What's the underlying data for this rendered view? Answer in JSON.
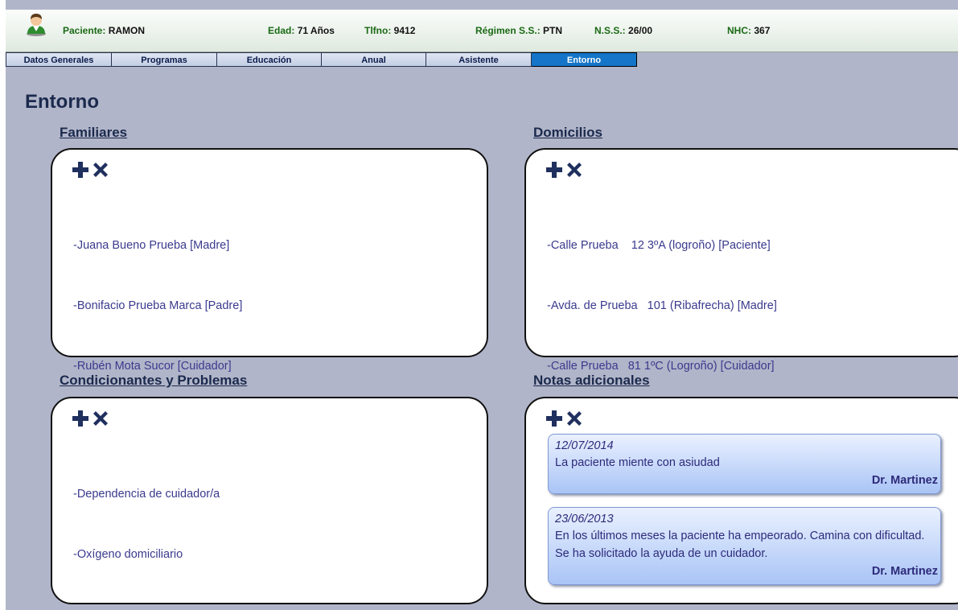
{
  "header": {
    "patient_label": "Paciente:",
    "patient_value": "RAMON",
    "age_label": "Edad:",
    "age_value": "71 Años",
    "phone_label": "Tlfno:",
    "phone_value": "9412",
    "regime_label": "Régimen S.S.:",
    "regime_value": "PTN",
    "nss_label": "N.S.S.:",
    "nss_value": "26/00",
    "nhc_label": "NHC:",
    "nhc_value": "367",
    "avatar_icon": "user-avatar-icon"
  },
  "tabs": [
    {
      "label": "Datos Generales"
    },
    {
      "label": "Programas"
    },
    {
      "label": "Educación"
    },
    {
      "label": "Anual"
    },
    {
      "label": "Asistente"
    },
    {
      "label": "Entorno"
    }
  ],
  "active_tab": "Entorno",
  "page_title": "Entorno",
  "sections": {
    "familiares": {
      "title": "Familiares",
      "items": [
        "-Juana Bueno Prueba [Madre]",
        "-Bonifacio Prueba Marca [Padre]",
        "-Rubén Mota Sucor [Cuidador]"
      ]
    },
    "domicilios": {
      "title": "Domicilios",
      "items": [
        "-Calle Prueba    12 3ºA (logroño) [Paciente]",
        "-Avda. de Prueba   101 (Ribafrecha) [Madre]",
        "-Calle Prueba   81 1ºC (Logroño) [Cuidador]"
      ]
    },
    "condicionantes": {
      "title": "Condicionantes y Problemas",
      "items": [
        "-Dependencia de cuidador/a",
        "-Oxígeno domiciliario"
      ]
    },
    "notas": {
      "title": "Notas adicionales",
      "items": [
        {
          "date": "12/07/2014",
          "text": "La paciente miente con asiudad",
          "author": "Dr. Martinez"
        },
        {
          "date": "23/06/2013",
          "text": "En los últimos meses la paciente ha empeorado. Camina con dificultad. Se ha solicitado la ayuda de un cuidador.",
          "author": "Dr. Martinez"
        }
      ]
    }
  },
  "icons": {
    "add": "plus-icon",
    "remove": "x-icon"
  },
  "colors": {
    "background": "#b1b5c9",
    "active_tab": "#1575c8",
    "header_label": "#1b6a15",
    "list_text": "#3a3a8e",
    "title_text": "#1b2a4d",
    "note_bg": "#a9c4f6"
  }
}
